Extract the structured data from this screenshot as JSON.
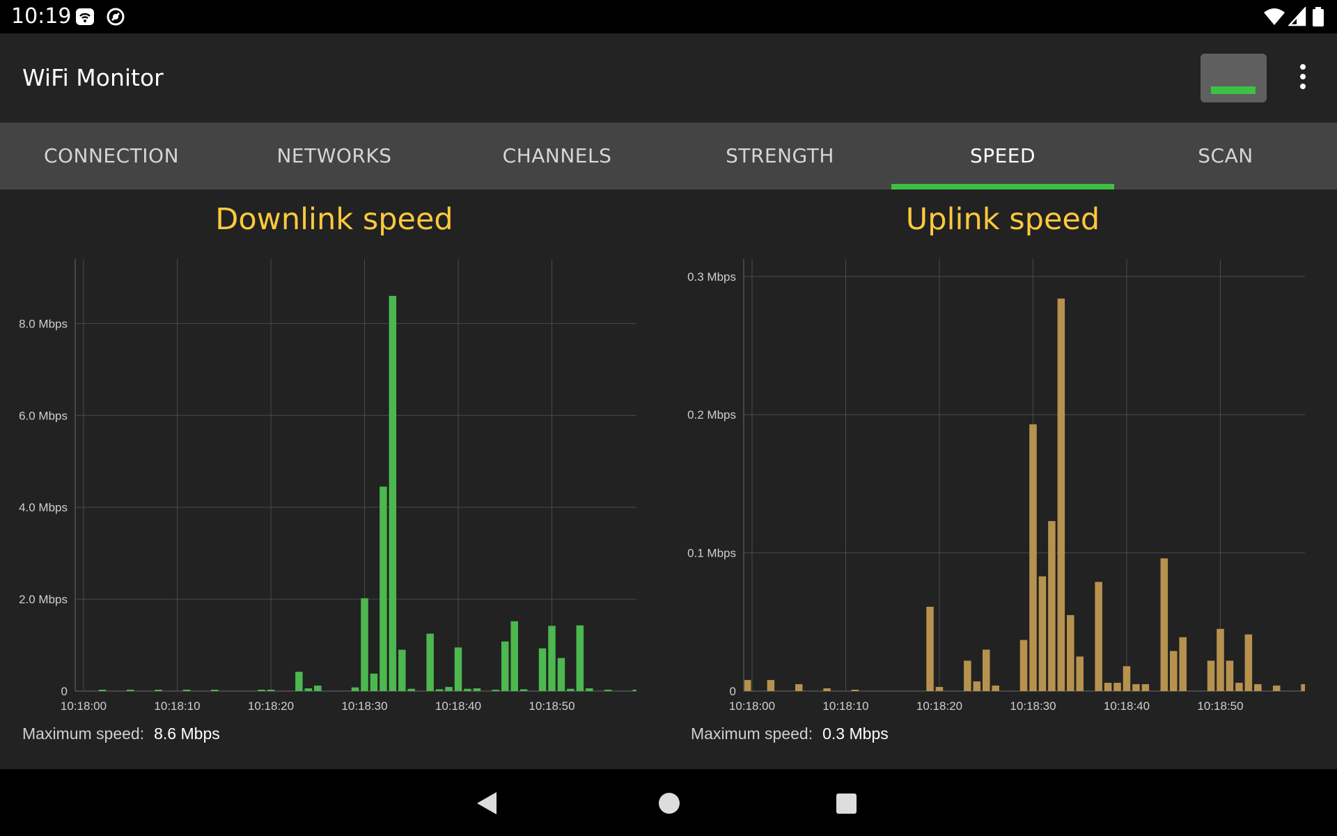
{
  "status_bar": {
    "time": "10:19",
    "icons_left": [
      "wifi-settings-icon",
      "no-tracking-icon"
    ],
    "icons_right": [
      "wifi-signal-icon",
      "cell-signal-icon",
      "battery-icon"
    ]
  },
  "app_bar": {
    "title": "WiFi Monitor",
    "widget_icon": "widget-icon",
    "menu_icon": "more-vert-icon"
  },
  "tabs": [
    {
      "label": "CONNECTION",
      "active": false
    },
    {
      "label": "NETWORKS",
      "active": false
    },
    {
      "label": "CHANNELS",
      "active": false
    },
    {
      "label": "STRENGTH",
      "active": false
    },
    {
      "label": "SPEED",
      "active": true
    },
    {
      "label": "SCAN",
      "active": false
    }
  ],
  "colors": {
    "accent": "#3ec045",
    "title": "#ffc93c",
    "downlink_bars": "#4cb84f",
    "uplink_bars": "#b7924f"
  },
  "downlink": {
    "title": "Downlink speed",
    "max_label": "Maximum speed:",
    "max_value": "8.6 Mbps"
  },
  "uplink": {
    "title": "Uplink speed",
    "max_label": "Maximum speed:",
    "max_value": "0.3 Mbps"
  },
  "chart_data": [
    {
      "type": "bar",
      "title": "Downlink speed",
      "x_tick_labels": [
        "10:18:00",
        "10:18:10",
        "10:18:20",
        "10:18:30",
        "10:18:40",
        "10:18:50"
      ],
      "y_tick_labels": [
        "0",
        "2.0 Mbps",
        "4.0 Mbps",
        "6.0 Mbps",
        "8.0 Mbps"
      ],
      "y_ticks": [
        0,
        2,
        4,
        6,
        8
      ],
      "ylim": [
        0,
        9.4
      ],
      "x_start_second": 0,
      "x_end_second": 59,
      "unit": "Mbps",
      "grid": true,
      "points": [
        {
          "t": 2,
          "v": 0.02
        },
        {
          "t": 5,
          "v": 0.03
        },
        {
          "t": 8,
          "v": 0.02
        },
        {
          "t": 11,
          "v": 0.02
        },
        {
          "t": 14,
          "v": 0.02
        },
        {
          "t": 19,
          "v": 0.03
        },
        {
          "t": 20,
          "v": 0.02
        },
        {
          "t": 23,
          "v": 0.42
        },
        {
          "t": 24,
          "v": 0.06
        },
        {
          "t": 25,
          "v": 0.12
        },
        {
          "t": 29,
          "v": 0.08
        },
        {
          "t": 30,
          "v": 2.02
        },
        {
          "t": 31,
          "v": 0.38
        },
        {
          "t": 32,
          "v": 4.45
        },
        {
          "t": 33,
          "v": 8.6
        },
        {
          "t": 34,
          "v": 0.9
        },
        {
          "t": 35,
          "v": 0.05
        },
        {
          "t": 37,
          "v": 1.25
        },
        {
          "t": 38,
          "v": 0.04
        },
        {
          "t": 39,
          "v": 0.09
        },
        {
          "t": 40,
          "v": 0.95
        },
        {
          "t": 41,
          "v": 0.05
        },
        {
          "t": 42,
          "v": 0.06
        },
        {
          "t": 44,
          "v": 0.03
        },
        {
          "t": 45,
          "v": 1.08
        },
        {
          "t": 46,
          "v": 1.52
        },
        {
          "t": 47,
          "v": 0.04
        },
        {
          "t": 49,
          "v": 0.93
        },
        {
          "t": 50,
          "v": 1.42
        },
        {
          "t": 51,
          "v": 0.72
        },
        {
          "t": 52,
          "v": 0.05
        },
        {
          "t": 53,
          "v": 1.43
        },
        {
          "t": 54,
          "v": 0.06
        },
        {
          "t": 56,
          "v": 0.02
        },
        {
          "t": 59,
          "v": 0.03
        }
      ]
    },
    {
      "type": "bar",
      "title": "Uplink speed",
      "x_tick_labels": [
        "10:18:00",
        "10:18:10",
        "10:18:20",
        "10:18:30",
        "10:18:40",
        "10:18:50"
      ],
      "y_tick_labels": [
        "0",
        "0.1 Mbps",
        "0.2 Mbps",
        "0.3 Mbps"
      ],
      "y_ticks": [
        0,
        0.1,
        0.2,
        0.3
      ],
      "ylim": [
        0,
        0.3125
      ],
      "x_start_second": 0,
      "x_end_second": 59,
      "unit": "Mbps",
      "grid": true,
      "points": [
        {
          "t": -0.5,
          "v": 0.008
        },
        {
          "t": 2,
          "v": 0.008
        },
        {
          "t": 5,
          "v": 0.005
        },
        {
          "t": 8,
          "v": 0.002
        },
        {
          "t": 11,
          "v": 0.001
        },
        {
          "t": 19,
          "v": 0.061
        },
        {
          "t": 20,
          "v": 0.003
        },
        {
          "t": 23,
          "v": 0.022
        },
        {
          "t": 24,
          "v": 0.007
        },
        {
          "t": 25,
          "v": 0.03
        },
        {
          "t": 26,
          "v": 0.004
        },
        {
          "t": 29,
          "v": 0.037
        },
        {
          "t": 30,
          "v": 0.193
        },
        {
          "t": 31,
          "v": 0.083
        },
        {
          "t": 32,
          "v": 0.123
        },
        {
          "t": 33,
          "v": 0.284
        },
        {
          "t": 34,
          "v": 0.055
        },
        {
          "t": 35,
          "v": 0.025
        },
        {
          "t": 37,
          "v": 0.079
        },
        {
          "t": 38,
          "v": 0.006
        },
        {
          "t": 39,
          "v": 0.006
        },
        {
          "t": 40,
          "v": 0.018
        },
        {
          "t": 41,
          "v": 0.005
        },
        {
          "t": 42,
          "v": 0.005
        },
        {
          "t": 44,
          "v": 0.096
        },
        {
          "t": 45,
          "v": 0.029
        },
        {
          "t": 46,
          "v": 0.039
        },
        {
          "t": 49,
          "v": 0.022
        },
        {
          "t": 50,
          "v": 0.045
        },
        {
          "t": 51,
          "v": 0.022
        },
        {
          "t": 52,
          "v": 0.006
        },
        {
          "t": 53,
          "v": 0.041
        },
        {
          "t": 54,
          "v": 0.005
        },
        {
          "t": 56,
          "v": 0.004
        },
        {
          "t": 59,
          "v": 0.005
        }
      ]
    }
  ]
}
